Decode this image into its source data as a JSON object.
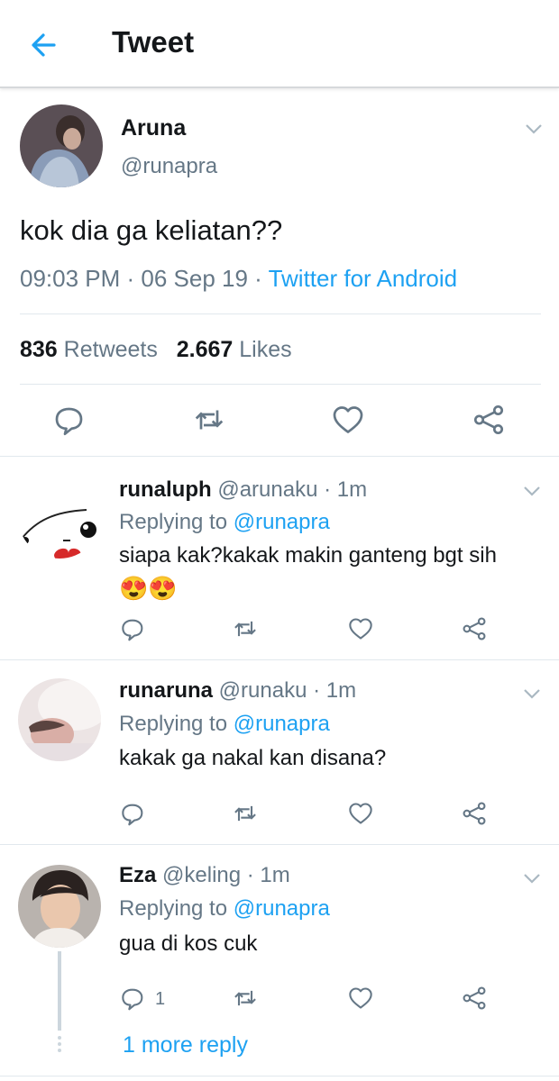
{
  "header": {
    "title": "Tweet"
  },
  "tweet": {
    "name": "Aruna",
    "handle": "@runapra",
    "text": "kok dia ga keliatan??",
    "time": "09:03 PM · 06 Sep 19 · ",
    "source": "Twitter for Android",
    "retweets_count": "836",
    "retweets_label": " Retweets",
    "likes_count": "2.667",
    "likes_label": " Likes"
  },
  "replies": [
    {
      "name": "runaluph",
      "handle_time": " @arunaku · 1m",
      "replying_prefix": "Replying to ",
      "replying_handle": "@runapra",
      "text": "siapa kak?kakak makin ganteng bgt sih",
      "emoji": "😍😍"
    },
    {
      "name": "runaruna",
      "handle_time": " @runaku · 1m",
      "replying_prefix": "Replying to ",
      "replying_handle": "@runapra",
      "text": "kakak ga nakal kan disana?"
    },
    {
      "name": "Eza",
      "handle_time": " @keling · 1m",
      "replying_prefix": "Replying to ",
      "replying_handle": "@runapra",
      "text": "gua di kos cuk",
      "reply_count": "1"
    }
  ],
  "more_replies": "1 more reply",
  "colors": {
    "accent": "#1da1f2",
    "secondary": "#657786",
    "text": "#14171a"
  },
  "icons": [
    "back-arrow-icon",
    "chevron-down-icon",
    "reply-icon",
    "retweet-icon",
    "like-icon",
    "share-icon"
  ]
}
